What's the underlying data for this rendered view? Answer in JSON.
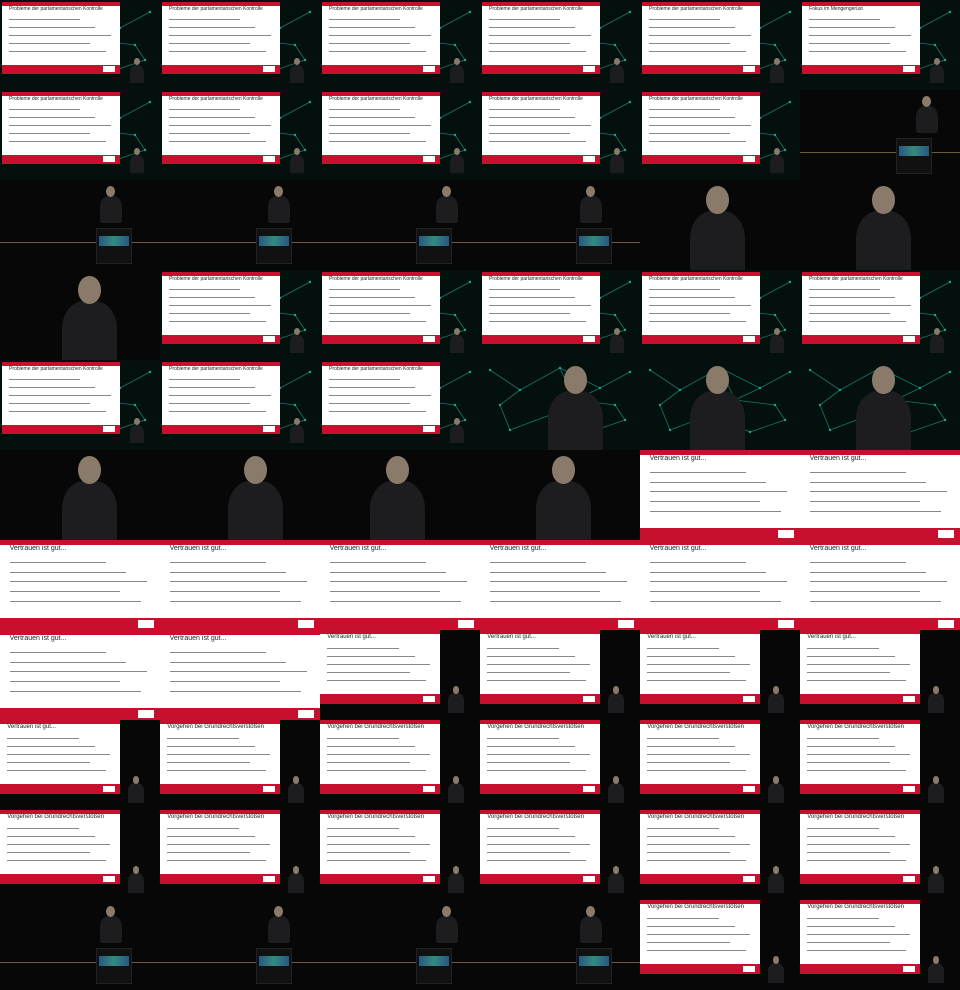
{
  "grid": {
    "columns": 6,
    "rows": 11
  },
  "cells": [
    {
      "kind": "slide-net",
      "text": "Probleme der parlamentarischen Kontrolle"
    },
    {
      "kind": "slide-net",
      "text": "Probleme der parlamentarischen Kontrolle"
    },
    {
      "kind": "slide-net",
      "text": "Probleme der parlamentarischen Kontrolle"
    },
    {
      "kind": "slide-net",
      "text": "Probleme der parlamentarischen Kontrolle"
    },
    {
      "kind": "slide-net",
      "text": "Probleme der parlamentarischen Kontrolle"
    },
    {
      "kind": "slide-net",
      "text": "Fokus im Mengengerüst"
    },
    {
      "kind": "slide-net",
      "text": "Probleme der parlamentarischen Kontrolle"
    },
    {
      "kind": "slide-net",
      "text": "Probleme der parlamentarischen Kontrolle"
    },
    {
      "kind": "slide-net",
      "text": "Probleme der parlamentarischen Kontrolle"
    },
    {
      "kind": "slide-net",
      "text": "Probleme der parlamentarischen Kontrolle"
    },
    {
      "kind": "slide-net",
      "text": "Probleme der parlamentarischen Kontrolle"
    },
    {
      "kind": "stage-podium",
      "text": ""
    },
    {
      "kind": "stage-podium",
      "text": ""
    },
    {
      "kind": "stage-podium",
      "text": ""
    },
    {
      "kind": "stage-podium",
      "text": ""
    },
    {
      "kind": "stage-podium",
      "text": ""
    },
    {
      "kind": "closeup",
      "text": ""
    },
    {
      "kind": "closeup",
      "text": ""
    },
    {
      "kind": "closeup",
      "text": ""
    },
    {
      "kind": "slide-net",
      "text": "Probleme der parlamentarischen Kontrolle"
    },
    {
      "kind": "slide-net",
      "text": "Probleme der parlamentarischen Kontrolle"
    },
    {
      "kind": "slide-net",
      "text": "Probleme der parlamentarischen Kontrolle"
    },
    {
      "kind": "slide-net",
      "text": "Probleme der parlamentarischen Kontrolle"
    },
    {
      "kind": "slide-net",
      "text": "Probleme der parlamentarischen Kontrolle"
    },
    {
      "kind": "slide-net",
      "text": "Probleme der parlamentarischen Kontrolle"
    },
    {
      "kind": "slide-net",
      "text": "Probleme der parlamentarischen Kontrolle"
    },
    {
      "kind": "slide-net",
      "text": "Probleme der parlamentarischen Kontrolle"
    },
    {
      "kind": "closeup-net",
      "text": ""
    },
    {
      "kind": "closeup-net",
      "text": ""
    },
    {
      "kind": "closeup-net",
      "text": ""
    },
    {
      "kind": "closeup",
      "text": ""
    },
    {
      "kind": "closeup",
      "text": ""
    },
    {
      "kind": "closeup",
      "text": ""
    },
    {
      "kind": "closeup",
      "text": ""
    },
    {
      "kind": "slide-full",
      "text": "Vertrauen ist gut..."
    },
    {
      "kind": "slide-full",
      "text": "Vertrauen ist gut..."
    },
    {
      "kind": "slide-full",
      "text": "Vertrauen ist gut..."
    },
    {
      "kind": "slide-full",
      "text": "Vertrauen ist gut..."
    },
    {
      "kind": "slide-full",
      "text": "Vertrauen ist gut..."
    },
    {
      "kind": "slide-full",
      "text": "Vertrauen ist gut..."
    },
    {
      "kind": "slide-full",
      "text": "Vertrauen ist gut..."
    },
    {
      "kind": "slide-full",
      "text": "Vertrauen ist gut..."
    },
    {
      "kind": "slide-full",
      "text": "Vertrauen ist gut..."
    },
    {
      "kind": "slide-full",
      "text": "Vertrauen ist gut..."
    },
    {
      "kind": "slide-dark",
      "text": "Vertrauen ist gut..."
    },
    {
      "kind": "slide-dark",
      "text": "Vertrauen ist gut..."
    },
    {
      "kind": "slide-dark",
      "text": "Vertrauen ist gut..."
    },
    {
      "kind": "slide-dark",
      "text": "Vertrauen ist gut..."
    },
    {
      "kind": "slide-dark",
      "text": "Vertrauen ist gut..."
    },
    {
      "kind": "slide-dark",
      "text": "Vorgehen bei Grundrechtsverstößen"
    },
    {
      "kind": "slide-dark",
      "text": "Vorgehen bei Grundrechtsverstößen"
    },
    {
      "kind": "slide-dark",
      "text": "Vorgehen bei Grundrechtsverstößen"
    },
    {
      "kind": "slide-dark",
      "text": "Vorgehen bei Grundrechtsverstößen"
    },
    {
      "kind": "slide-dark",
      "text": "Vorgehen bei Grundrechtsverstößen"
    },
    {
      "kind": "slide-dark",
      "text": "Vorgehen bei Grundrechtsverstößen"
    },
    {
      "kind": "slide-dark",
      "text": "Vorgehen bei Grundrechtsverstößen"
    },
    {
      "kind": "slide-dark",
      "text": "Vorgehen bei Grundrechtsverstößen"
    },
    {
      "kind": "slide-dark",
      "text": "Vorgehen bei Grundrechtsverstößen"
    },
    {
      "kind": "slide-dark",
      "text": "Vorgehen bei Grundrechtsverstößen"
    },
    {
      "kind": "slide-dark",
      "text": "Vorgehen bei Grundrechtsverstößen"
    },
    {
      "kind": "stage-podium",
      "text": ""
    },
    {
      "kind": "stage-podium",
      "text": ""
    },
    {
      "kind": "stage-podium",
      "text": ""
    },
    {
      "kind": "stage-podium",
      "text": ""
    },
    {
      "kind": "slide-dark",
      "text": "Vorgehen bei Grundrechtsverstößen"
    },
    {
      "kind": "slide-dark",
      "text": "Vorgehen bei Grundrechtsverstößen"
    }
  ],
  "podium_label": "INFOSEC",
  "colors": {
    "accent": "#c8102e",
    "net": "#1aa58e"
  }
}
